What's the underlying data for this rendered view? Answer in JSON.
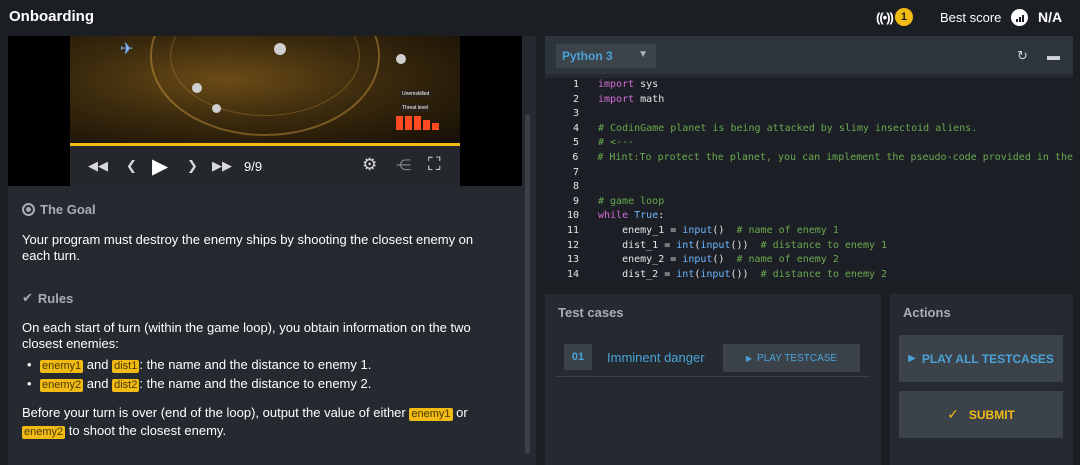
{
  "topbar": {
    "title": "Onboarding",
    "live_count": "1",
    "best_score_label": "Best score",
    "best_score_value": "N/A"
  },
  "player": {
    "frame": "9/9",
    "hud_labels": [
      "Unemskilled",
      "Threat level"
    ],
    "progress_fraction": 1.0
  },
  "statement": {
    "goal_heading": "The Goal",
    "goal_text": "Your program must destroy the enemy ships by shooting the closest enemy on each turn.",
    "rules_heading": "Rules",
    "rules_intro": "On each start of turn (within the game loop), you obtain information on the two closest enemies:",
    "bullets": [
      {
        "var1": "enemy1",
        "and": "and",
        "var2": "dist1",
        "text": ": the name and the distance to enemy 1."
      },
      {
        "var1": "enemy2",
        "and": "and",
        "var2": "dist2",
        "text": ": the name and the distance to enemy 2."
      }
    ],
    "closing_pre": "Before your turn is over (end of the loop), output the value of either",
    "closing_var1": "enemy1",
    "closing_or": "or",
    "closing_var2": "enemy2",
    "closing_post": "to shoot the closest enemy."
  },
  "editor": {
    "language": "Python 3",
    "lines": [
      {
        "n": "1",
        "parts": [
          [
            "kw",
            "import"
          ],
          [
            "pl",
            " sys"
          ]
        ]
      },
      {
        "n": "2",
        "parts": [
          [
            "kw",
            "import"
          ],
          [
            "pl",
            " math"
          ]
        ]
      },
      {
        "n": "3",
        "parts": []
      },
      {
        "n": "4",
        "parts": [
          [
            "cm",
            "# CodinGame planet is being attacked by slimy insectoid aliens."
          ]
        ]
      },
      {
        "n": "5",
        "parts": [
          [
            "cm",
            "# <---"
          ]
        ]
      },
      {
        "n": "6",
        "parts": [
          [
            "cm",
            "# Hint:To protect the planet, you can implement the pseudo-code provided in the"
          ]
        ]
      },
      {
        "n": "7",
        "parts": []
      },
      {
        "n": "8",
        "parts": []
      },
      {
        "n": "9",
        "parts": [
          [
            "cm",
            "# game loop"
          ]
        ]
      },
      {
        "n": "10",
        "parts": [
          [
            "kw",
            "while"
          ],
          [
            "pl",
            " "
          ],
          [
            "bi",
            "True"
          ],
          [
            "pl",
            ":"
          ]
        ]
      },
      {
        "n": "11",
        "parts": [
          [
            "pl",
            "    enemy_1 = "
          ],
          [
            "bi",
            "input"
          ],
          [
            "pl",
            "()  "
          ],
          [
            "cm",
            "# name of enemy 1"
          ]
        ]
      },
      {
        "n": "12",
        "parts": [
          [
            "pl",
            "    dist_1 = "
          ],
          [
            "bi",
            "int"
          ],
          [
            "pl",
            "("
          ],
          [
            "bi",
            "input"
          ],
          [
            "pl",
            "())  "
          ],
          [
            "cm",
            "# distance to enemy 1"
          ]
        ]
      },
      {
        "n": "13",
        "parts": [
          [
            "pl",
            "    enemy_2 = "
          ],
          [
            "bi",
            "input"
          ],
          [
            "pl",
            "()  "
          ],
          [
            "cm",
            "# name of enemy 2"
          ]
        ]
      },
      {
        "n": "14",
        "parts": [
          [
            "pl",
            "    dist_2 = "
          ],
          [
            "bi",
            "int"
          ],
          [
            "pl",
            "("
          ],
          [
            "bi",
            "input"
          ],
          [
            "pl",
            "())  "
          ],
          [
            "cm",
            "# distance to enemy 2"
          ]
        ]
      }
    ]
  },
  "tests": {
    "heading": "Test cases",
    "items": [
      {
        "num": "01",
        "name": "Imminent danger",
        "button": "PLAY TESTCASE"
      }
    ]
  },
  "actions": {
    "heading": "Actions",
    "play_all": "PLAY ALL TESTCASES",
    "submit": "SUBMIT"
  },
  "colors": {
    "accent_blue": "#4aa3d8",
    "accent_yellow": "#f2bb13",
    "panel": "#252a30",
    "background": "#1b1e22"
  }
}
